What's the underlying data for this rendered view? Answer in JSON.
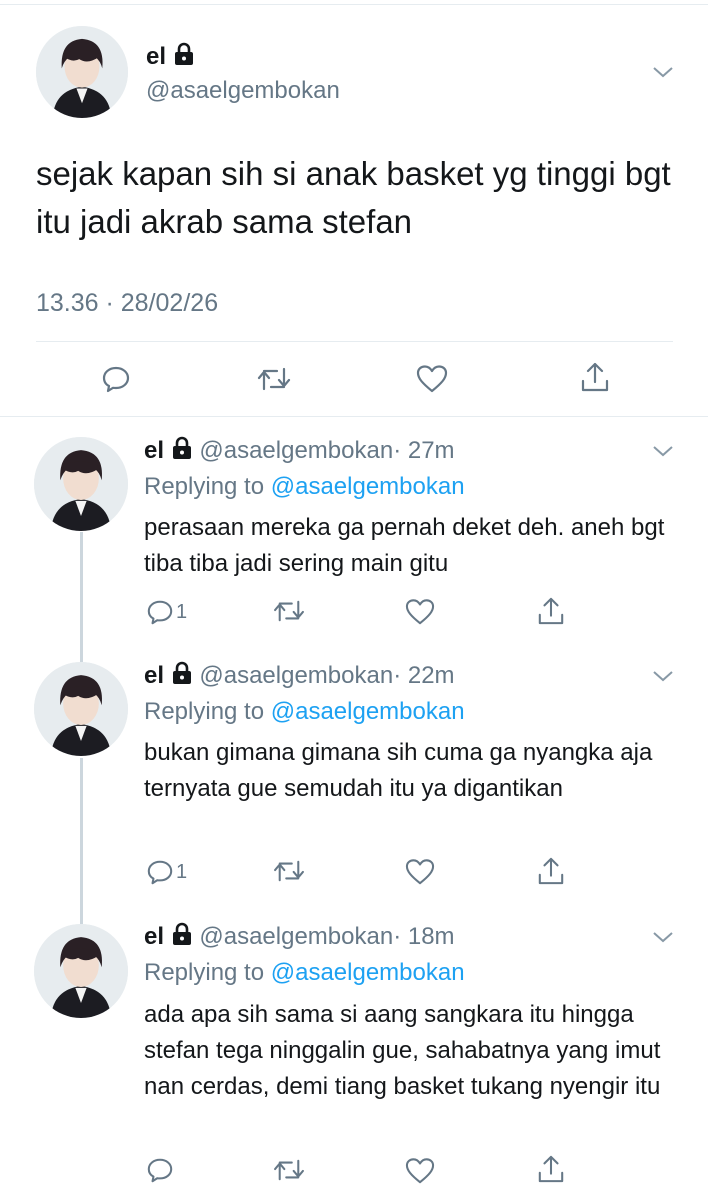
{
  "main_tweet": {
    "name": "el",
    "handle": "@asaelgembokan",
    "text": "sejak kapan sih si anak basket yg tinggi bgt itu jadi akrab sama stefan",
    "timestamp": "13.36 · 28/02/26",
    "actions": [
      "reply-icon",
      "retweet-icon",
      "like-icon",
      "share-icon"
    ]
  },
  "replies": [
    {
      "name": "el",
      "handle": "@asaelgembokan",
      "time": "· 27m",
      "replying_prefix": "Replying to",
      "replying_to": "@asaelgembokan",
      "text": "perasaan mereka ga pernah deket deh. aneh bgt tiba tiba jadi sering main gitu",
      "reply_count": "1"
    },
    {
      "name": "el",
      "handle": "@asaelgembokan",
      "time": "· 22m",
      "replying_prefix": "Replying to",
      "replying_to": "@asaelgembokan",
      "text": "bukan gimana gimana sih cuma ga nyangka aja ternyata gue semudah itu ya digantikan",
      "reply_count": "1"
    },
    {
      "name": "el",
      "handle": "@asaelgembokan",
      "time": "· 18m",
      "replying_prefix": "Replying to",
      "replying_to": "@asaelgembokan",
      "text": "ada apa sih sama si aang sangkara itu hingga stefan tega ninggalin gue, sahabatnya yang imut nan cerdas, demi tiang basket tukang nyengir itu",
      "reply_count": ""
    }
  ],
  "colors": {
    "text": "#14171a",
    "secondary": "#657786",
    "link": "#1da1f2",
    "divider": "#e6ecf0",
    "thread_line": "#ccd6dd"
  }
}
